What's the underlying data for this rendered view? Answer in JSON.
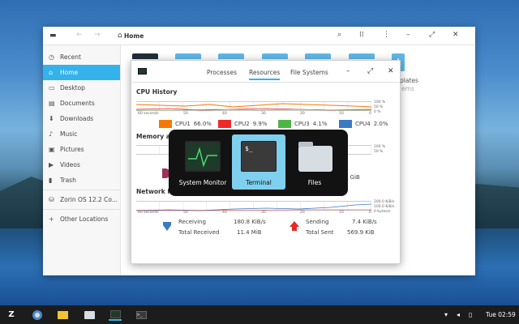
{
  "files": {
    "path_label": "Home",
    "sidebar": [
      {
        "icon": "clock-icon",
        "label": "Recent"
      },
      {
        "icon": "home-icon",
        "label": "Home",
        "active": true
      },
      {
        "icon": "desktop-icon",
        "label": "Desktop"
      },
      {
        "icon": "document-icon",
        "label": "Documents"
      },
      {
        "icon": "download-icon",
        "label": "Downloads"
      },
      {
        "icon": "music-icon",
        "label": "Music"
      },
      {
        "icon": "pictures-icon",
        "label": "Pictures"
      },
      {
        "icon": "video-icon",
        "label": "Videos"
      },
      {
        "icon": "trash-icon",
        "label": "Trash"
      },
      {
        "icon": "drive-icon",
        "label": "Zorin OS 12.2 Co..."
      },
      {
        "icon": "plus-icon",
        "label": "Other Locations"
      }
    ],
    "bg_label_1": "plates",
    "bg_label_2": "ems"
  },
  "sysmon": {
    "tabs": [
      "Processes",
      "Resources",
      "File Systems"
    ],
    "active_tab": "Resources",
    "cpu_title": "CPU History",
    "mem_title": "Memory and",
    "net_title": "Network Histo",
    "axis": [
      "60 seconds",
      "50",
      "40",
      "30",
      "20",
      "10",
      "0"
    ],
    "pct_top": "100 %",
    "pct_mid": "50 %",
    "pct_bot": "0 %",
    "mem_right": "5 GiB",
    "net_top": "200.0 KiB/s",
    "net_mid": "100.0 KiB/s",
    "net_bot": "0 bytes/s",
    "cpus": [
      {
        "name": "CPU1",
        "value": "66.0%",
        "color": "#f57900"
      },
      {
        "name": "CPU2",
        "value": "9.9%",
        "color": "#ef2929"
      },
      {
        "name": "CPU3",
        "value": "4.1%",
        "color": "#4eb446"
      },
      {
        "name": "CPU4",
        "value": "2.0%",
        "color": "#3a7ac1"
      }
    ],
    "receiving_label": "Receiving",
    "receiving": "180.8 KiB/s",
    "total_received_label": "Total Received",
    "total_received": "11.4 MiB",
    "sending_label": "Sending",
    "sending": "7.4 KiB/s",
    "total_sent_label": "Total Sent",
    "total_sent": "569.9 KiB"
  },
  "switcher": {
    "apps": [
      {
        "label": "System Monitor"
      },
      {
        "label": "Terminal",
        "selected": true
      },
      {
        "label": "Files"
      }
    ],
    "terminal_prompt": "$_"
  },
  "taskbar": {
    "clock": "Tue 02:59"
  }
}
